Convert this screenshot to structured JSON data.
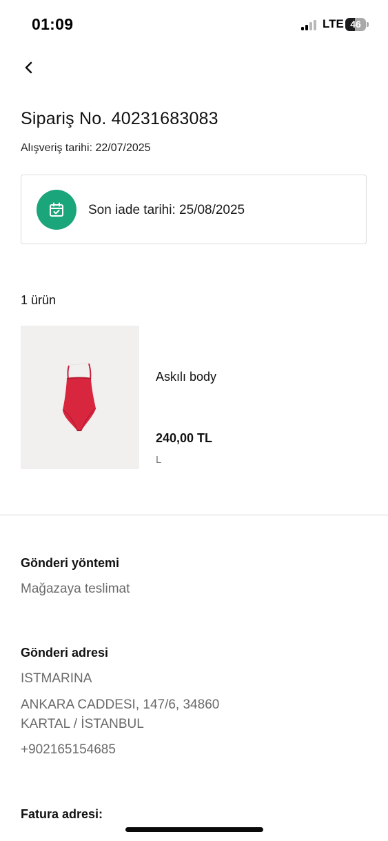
{
  "status_bar": {
    "time": "01:09",
    "network": "LTE",
    "battery": "46",
    "battery_level": 0.46,
    "signal_bars_active": 2,
    "signal_bars_total": 4
  },
  "header": {
    "back_icon": "chevron-left-icon"
  },
  "order": {
    "title": "Sipariş No. 40231683083",
    "purchase_date": "Alışveriş tarihi: 22/07/2025"
  },
  "return_card": {
    "icon": "calendar-check-icon",
    "text": "Son iade tarihi: 25/08/2025",
    "accent_color": "#1aa57a"
  },
  "items": {
    "count_label": "1 ürün",
    "products": [
      {
        "name": "Askılı body",
        "price": "240,00 TL",
        "size": "L",
        "image_color": "#d8263f"
      }
    ]
  },
  "shipping": {
    "method_heading": "Gönderi yöntemi",
    "method_value": "Mağazaya teslimat",
    "address_heading": "Gönderi adresi",
    "address_name": "ISTMARINA",
    "address_line1": "ANKARA CADDESI, 147/6, 34860",
    "address_line2": "KARTAL / İSTANBUL",
    "phone": "+902165154685"
  },
  "billing": {
    "heading": "Fatura adresi:"
  }
}
